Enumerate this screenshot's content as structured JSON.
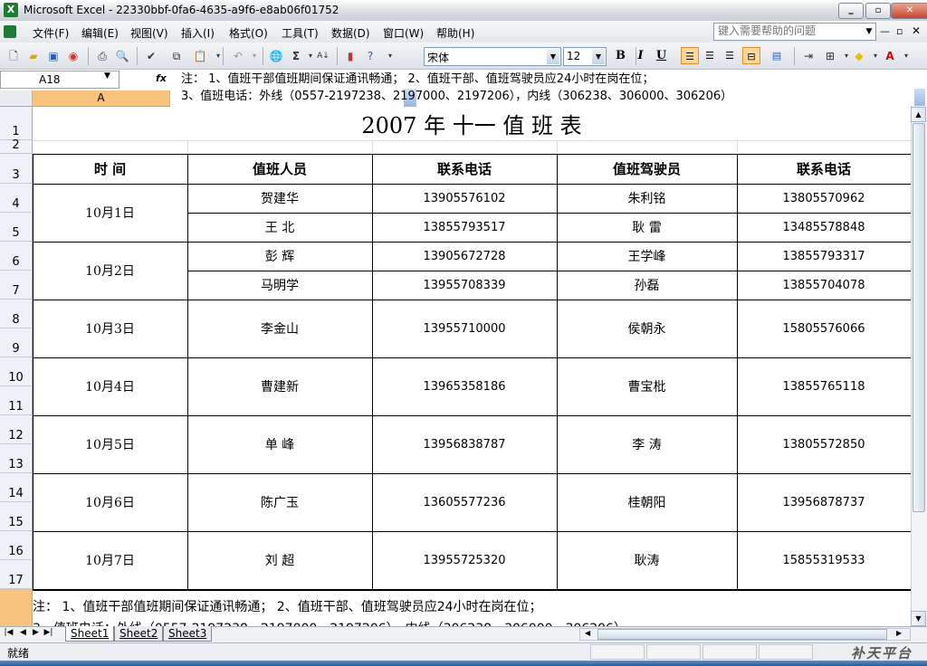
{
  "window": {
    "title": "Microsoft Excel - 22330bbf-0fa6-4635-a9f6-e8ab06f01752",
    "app_icon_letter": "X",
    "controls": [
      "‗",
      "▫",
      "✕"
    ]
  },
  "menu": {
    "items": [
      "文件(F)",
      "编辑(E)",
      "视图(V)",
      "插入(I)",
      "格式(O)",
      "工具(T)",
      "数据(D)",
      "窗口(W)",
      "帮助(H)"
    ],
    "help_placeholder": "键入需要帮助的问题"
  },
  "toolbar": {
    "font_name": "宋体",
    "font_size": "12",
    "bold": "B",
    "italic": "I",
    "underline": "U"
  },
  "formula_bar": {
    "name_box": "A18",
    "fx": "fx",
    "content_line1": "注：    1、值班干部值班期间保证通讯畅通；       2、值班干部、值班驾驶员应24小时在岗在位；",
    "content_line2": "3、值班电话：外线（0557-2197238、2197000、2197206），内线（306238、306000、306206）"
  },
  "grid": {
    "column_header": "A",
    "row_numbers": [
      "1",
      "2",
      "3",
      "4",
      "5",
      "6",
      "7",
      "8",
      "9",
      "10",
      "11",
      "12",
      "13",
      "14",
      "15",
      "16",
      "17"
    ],
    "title": "2007 年 十一 值 班 表",
    "headers": [
      "时   间",
      "值班人员",
      "联系电话",
      "值班驾驶员",
      "联系电话"
    ],
    "days": [
      {
        "date": "10月1日",
        "rows": [
          {
            "staff": "贺建华",
            "staff_phone": "13905576102",
            "driver": "朱利铭",
            "driver_phone": "13805570962"
          },
          {
            "staff": "王   北",
            "staff_phone": "13855793517",
            "driver": "耿   雷",
            "driver_phone": "13485578848"
          }
        ]
      },
      {
        "date": "10月2日",
        "rows": [
          {
            "staff": "彭   辉",
            "staff_phone": "13905672728",
            "driver": "王学峰",
            "driver_phone": "13855793317"
          },
          {
            "staff": "马明学",
            "staff_phone": "13955708339",
            "driver": "孙磊",
            "driver_phone": "13855704078"
          }
        ]
      },
      {
        "date": "10月3日",
        "rows": [
          {
            "staff": "李金山",
            "staff_phone": "13955710000",
            "driver": "侯朝永",
            "driver_phone": "15805576066"
          }
        ]
      },
      {
        "date": "10月4日",
        "rows": [
          {
            "staff": "曹建新",
            "staff_phone": "13965358186",
            "driver": "曹宝枇",
            "driver_phone": "13855765118"
          }
        ]
      },
      {
        "date": "10月5日",
        "rows": [
          {
            "staff": "单   峰",
            "staff_phone": "13956838787",
            "driver": "李   涛",
            "driver_phone": "13805572850"
          }
        ]
      },
      {
        "date": "10月6日",
        "rows": [
          {
            "staff": "陈广玉",
            "staff_phone": "13605577236",
            "driver": "桂朝阳",
            "driver_phone": "13956878737"
          }
        ]
      },
      {
        "date": "10月7日",
        "rows": [
          {
            "staff": "刘   超",
            "staff_phone": "13955725320",
            "driver": "耿涛",
            "driver_phone": "15855319533"
          }
        ]
      }
    ],
    "note_line1": "注：    1、值班干部值班期间保证通讯畅通；       2、值班干部、值班驾驶员应24小时在岗在位；",
    "note_line2": "3、值班电话：外线（0557-2197238、2197000、2197206），内线（306238、306000、306206）"
  },
  "tabs": [
    "Sheet1",
    "Sheet2",
    "Sheet3"
  ],
  "status": {
    "text": "就绪",
    "watermark": "补天平台"
  },
  "colors": {
    "selected_header": "#f7c37d",
    "accent": "#e68c2e"
  }
}
